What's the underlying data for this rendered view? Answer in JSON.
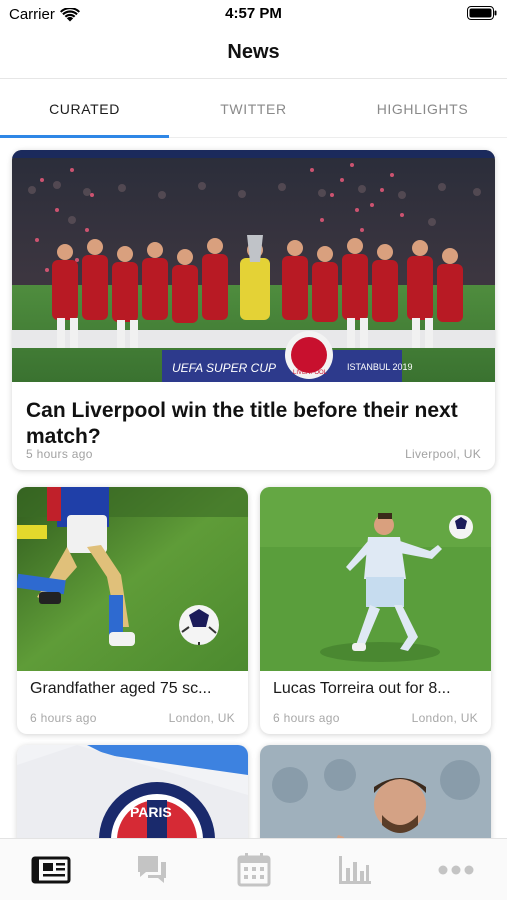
{
  "status_bar": {
    "carrier": "Carrier",
    "time": "4:57 PM"
  },
  "nav": {
    "title": "News"
  },
  "tabs": [
    {
      "label": "CURATED",
      "active": true
    },
    {
      "label": "TWITTER",
      "active": false
    },
    {
      "label": "HIGHLIGHTS",
      "active": false
    }
  ],
  "feed": {
    "hero": {
      "title": "Can Liverpool win the title before their next match?",
      "time": "5 hours ago",
      "location": "Liverpool, UK",
      "banner_text": "UEFA SUPER CUP",
      "banner_city": "ISTANBUL 2019",
      "crest_text": "LIVERPOOL"
    },
    "cards": [
      {
        "title": "Grandfather aged 75 sc...",
        "time": "6 hours ago",
        "location": "London, UK"
      },
      {
        "title": "Lucas Torreira out for 8...",
        "time": "6 hours ago",
        "location": "London, UK"
      },
      {
        "title": "",
        "time": "",
        "location": "",
        "flag_text": "PARIS"
      },
      {
        "title": "",
        "time": "",
        "location": ""
      }
    ]
  },
  "tab_bar": [
    {
      "icon": "newspaper-icon",
      "active": true
    },
    {
      "icon": "chat-icon",
      "active": false
    },
    {
      "icon": "calendar-icon",
      "active": false
    },
    {
      "icon": "bar-chart-icon",
      "active": false
    },
    {
      "icon": "more-icon",
      "active": false
    }
  ],
  "colors": {
    "accent": "#2f87e6",
    "liverpool_red": "#c8102e",
    "pitch_green": "#4f9e3a",
    "inactive_icon": "#c4c4c4"
  }
}
